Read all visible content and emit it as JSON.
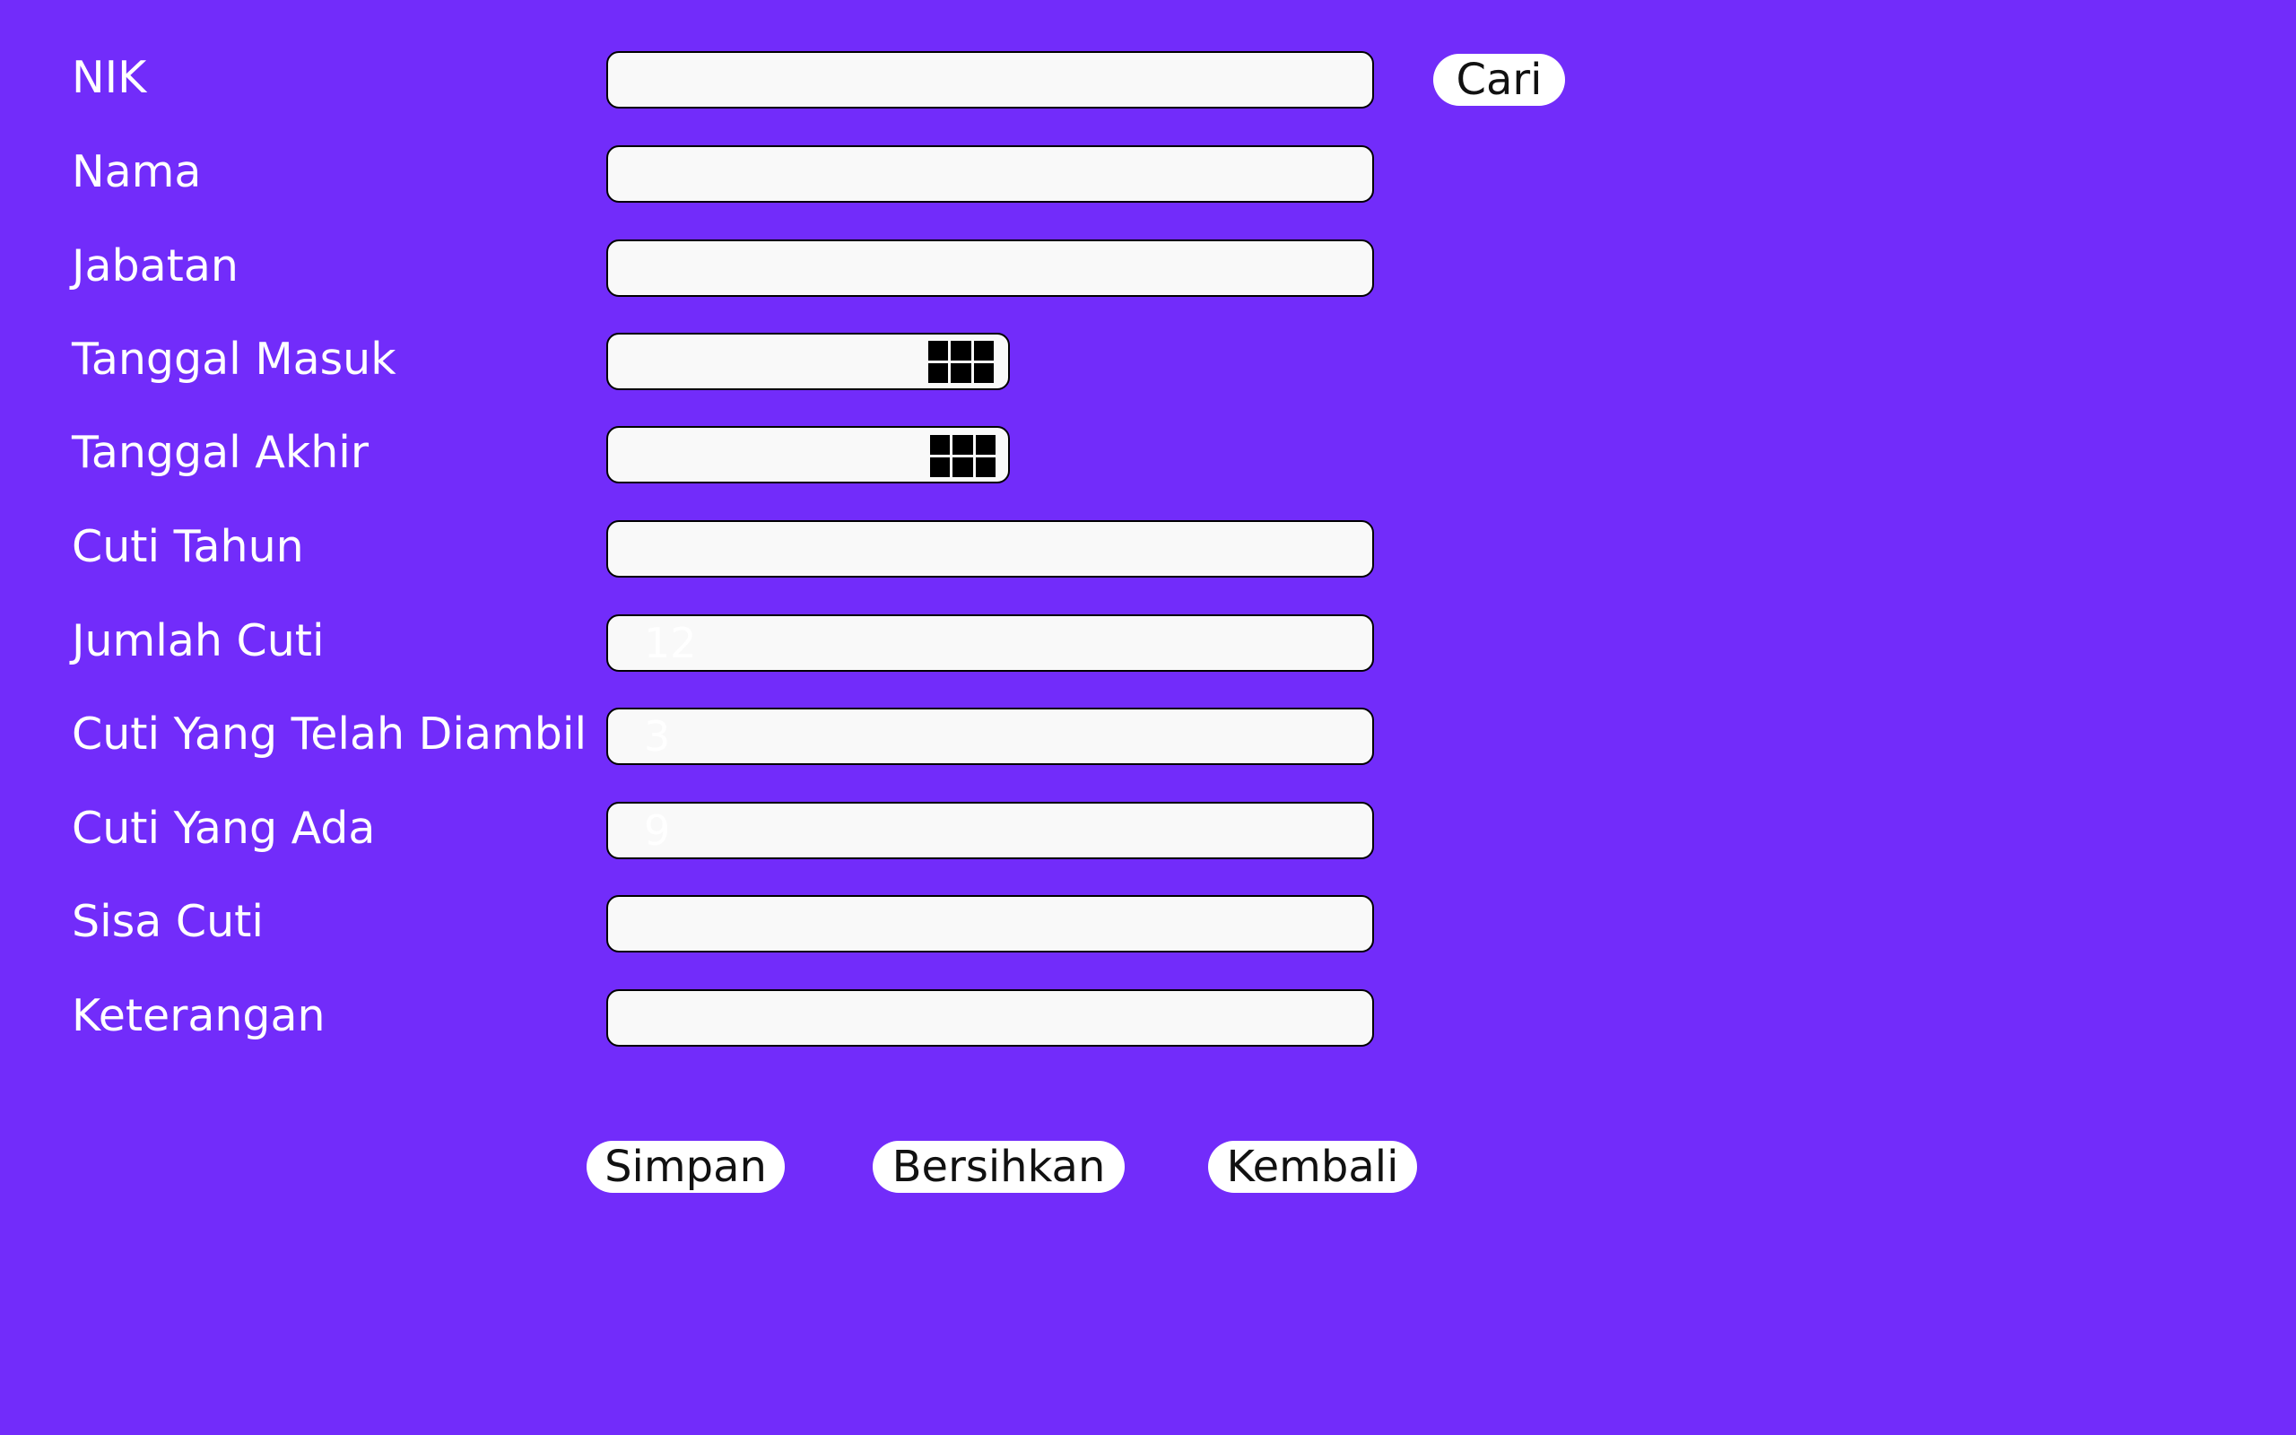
{
  "form": {
    "fields": [
      {
        "label": "NIK",
        "value": ""
      },
      {
        "label": "Nama",
        "value": ""
      },
      {
        "label": "Jabatan",
        "value": ""
      },
      {
        "label": "Tanggal Masuk",
        "value": "",
        "icon": "calendar-icon"
      },
      {
        "label": "Tanggal Akhir",
        "value": "",
        "icon": "calendar-icon"
      },
      {
        "label": "Cuti Tahun",
        "value": ""
      },
      {
        "label": "Jumlah Cuti",
        "value": "12"
      },
      {
        "label": "Cuti Yang Telah Diambil",
        "value": "3"
      },
      {
        "label": "Cuti Yang Ada",
        "value": "9"
      },
      {
        "label": "Sisa Cuti",
        "value": ""
      },
      {
        "label": "Keterangan",
        "value": ""
      }
    ],
    "search_button": "Cari"
  },
  "actions": {
    "save": "Simpan",
    "clear": "Bersihkan",
    "back": "Kembali"
  },
  "colors": {
    "background": "#722cfa",
    "field_background": "#f9f9f9",
    "label_text": "#ffffff",
    "field_text": "#ffffff"
  }
}
